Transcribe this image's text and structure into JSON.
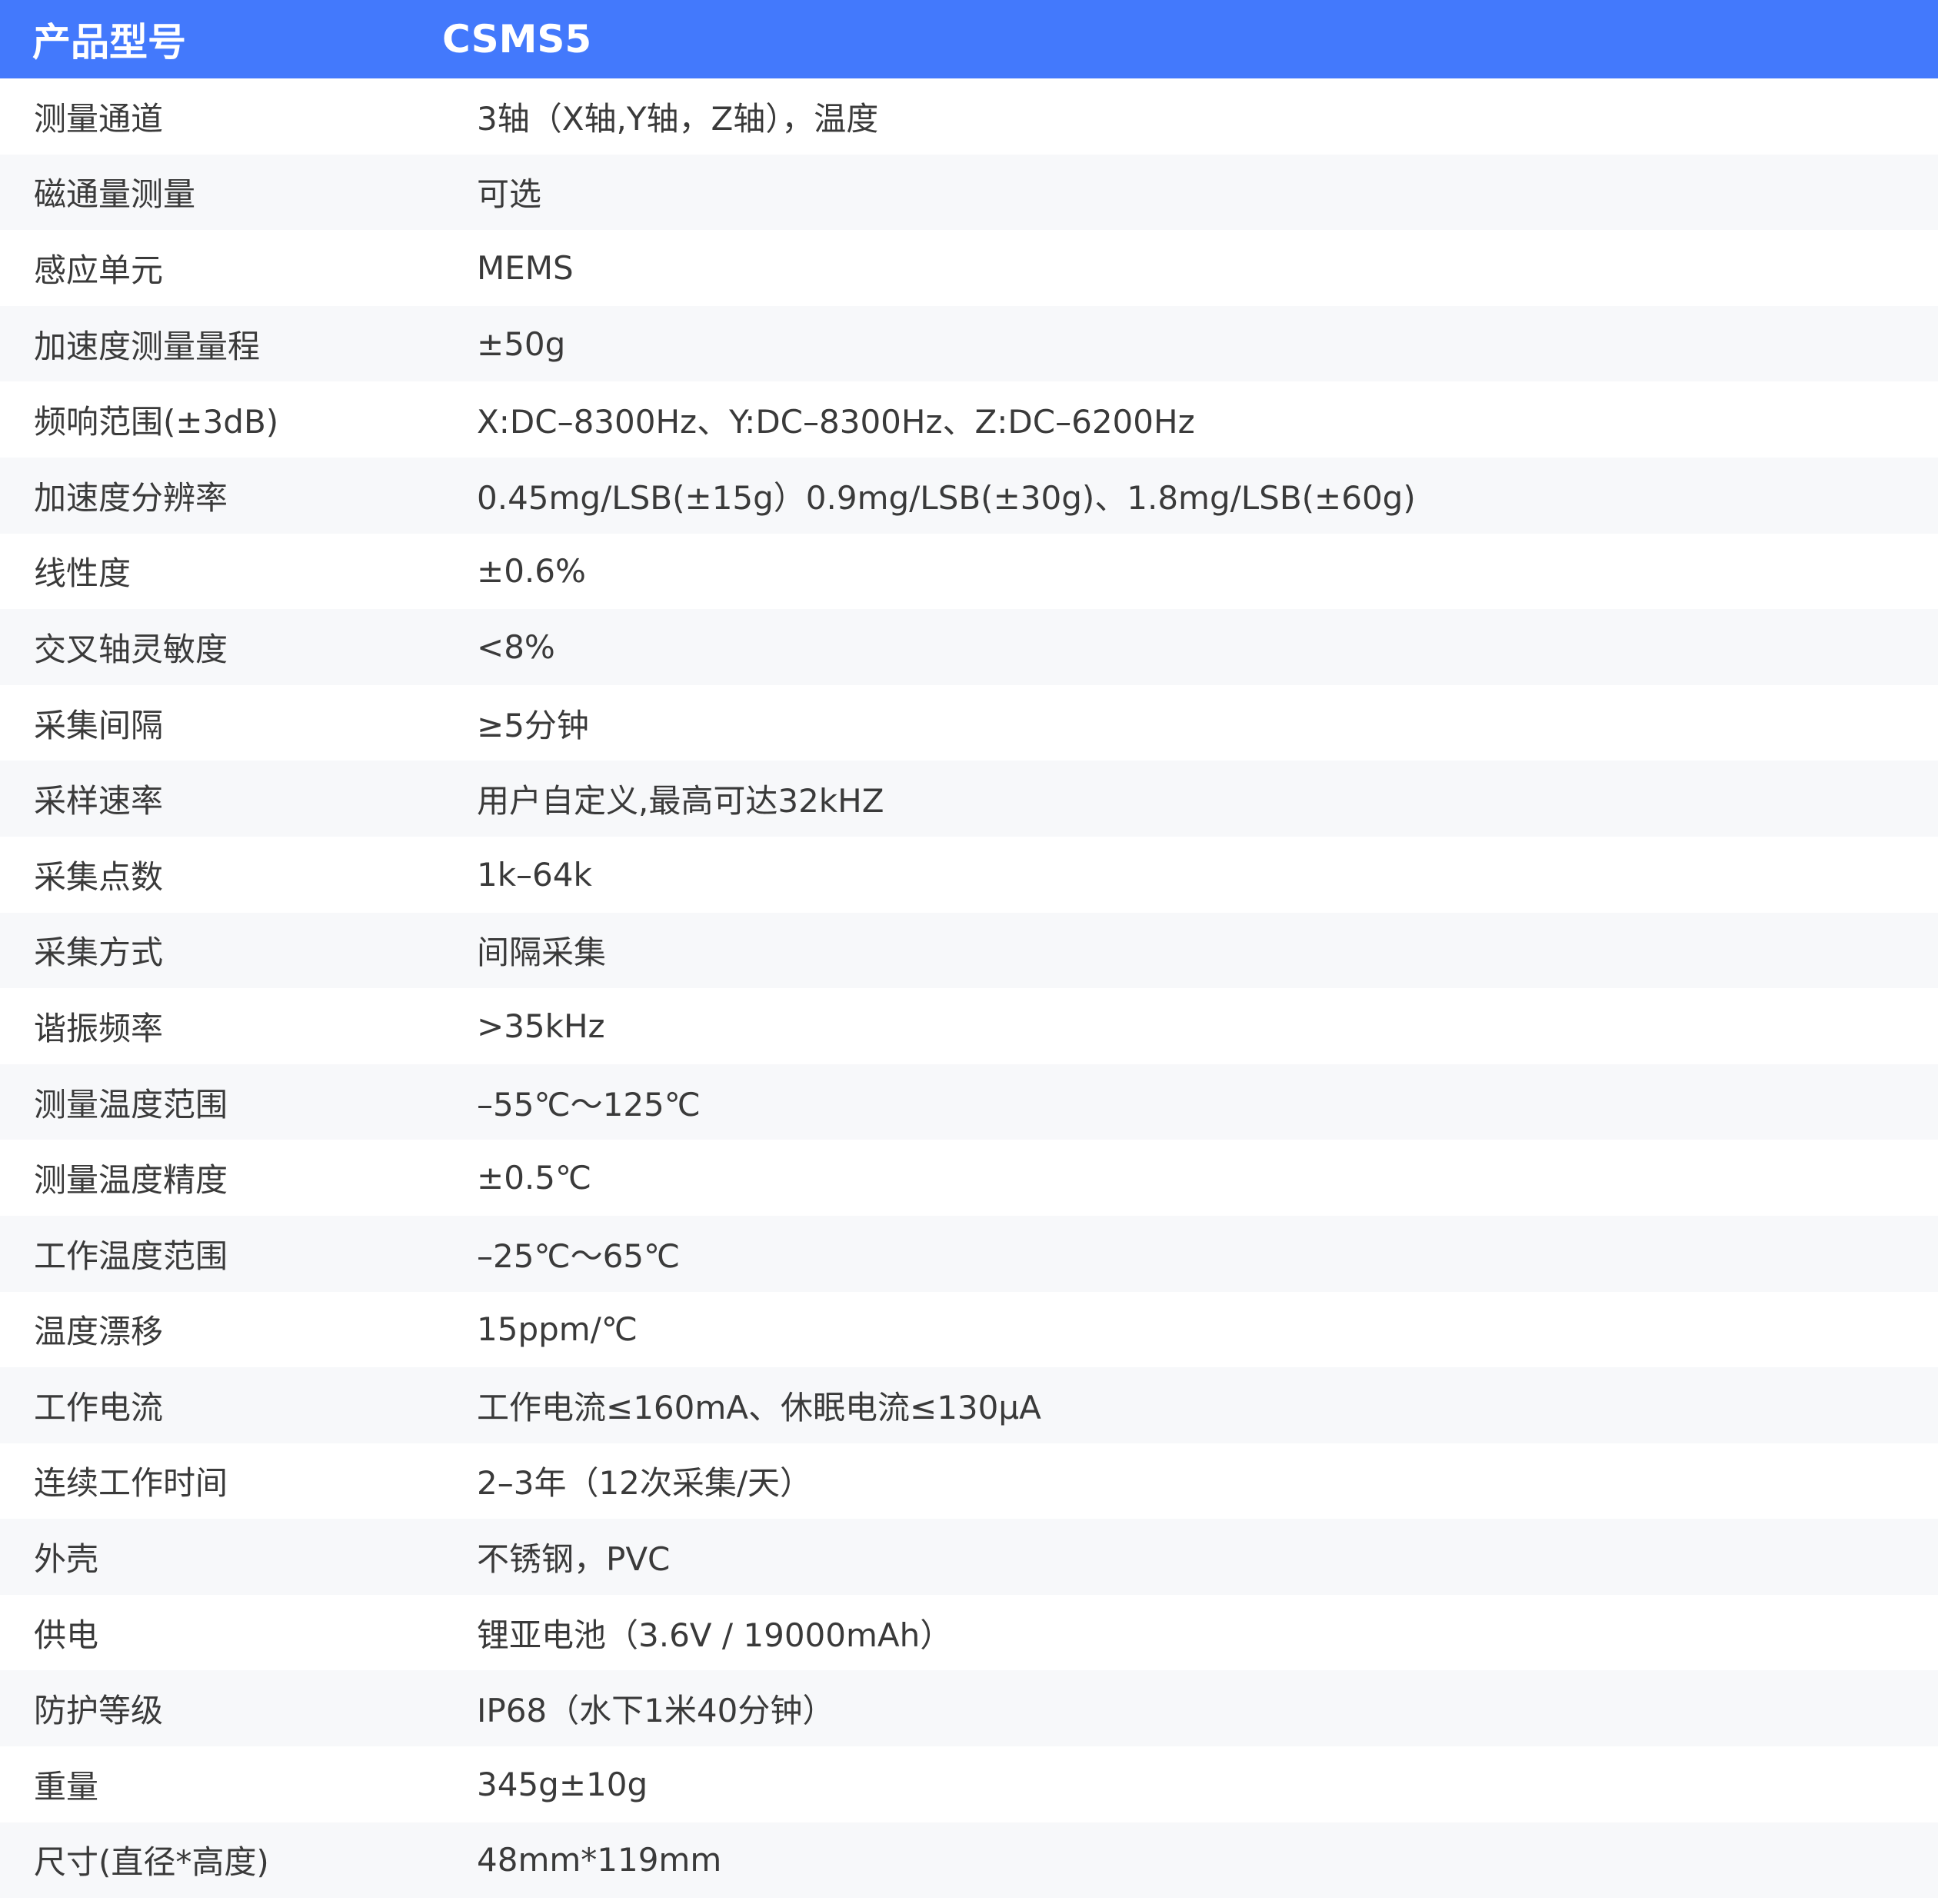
{
  "colors": {
    "header_bg": "#4379fc",
    "header_text": "#ffffff",
    "body_text": "#3a3a3a",
    "stripe": "#f7f8fa"
  },
  "header": {
    "label": "产品型号",
    "value": "CSMS5"
  },
  "rows": [
    {
      "label": "测量通道",
      "value": "3轴（X轴,Y轴，Z轴），温度"
    },
    {
      "label": "磁通量测量",
      "value": "可选"
    },
    {
      "label": "感应单元",
      "value": "MEMS"
    },
    {
      "label": "加速度测量量程",
      "value": "±50g"
    },
    {
      "label": "频响范围(±3dB)",
      "value": "X:DC–8300Hz、Y:DC–8300Hz、Z:DC–6200Hz"
    },
    {
      "label": "加速度分辨率",
      "value": "0.45mg/LSB(±15g）0.9mg/LSB(±30g)、1.8mg/LSB(±60g)"
    },
    {
      "label": "线性度",
      "value": "±0.6%"
    },
    {
      "label": "交叉轴灵敏度",
      "value": "<8%"
    },
    {
      "label": "采集间隔",
      "value": "≥5分钟"
    },
    {
      "label": "采样速率",
      "value": "用户自定义,最高可达32kHZ"
    },
    {
      "label": "采集点数",
      "value": "1k–64k"
    },
    {
      "label": "采集方式",
      "value": "间隔采集"
    },
    {
      "label": "谐振频率",
      "value": ">35kHz"
    },
    {
      "label": "测量温度范围",
      "value": "–55℃～125℃"
    },
    {
      "label": "测量温度精度",
      "value": "±0.5℃"
    },
    {
      "label": "工作温度范围",
      "value": "–25℃～65℃"
    },
    {
      "label": "温度漂移",
      "value": "15ppm/℃"
    },
    {
      "label": "工作电流",
      "value": "工作电流≤160mA、休眠电流≤130μA"
    },
    {
      "label": "连续工作时间",
      "value": "2–3年（12次采集/天）"
    },
    {
      "label": "外壳",
      "value": "不锈钢，PVC"
    },
    {
      "label": "供电",
      "value": "锂亚电池（3.6V / 19000mAh）"
    },
    {
      "label": "防护等级",
      "value": "IP68（水下1米40分钟）"
    },
    {
      "label": "重量",
      "value": "345g±10g"
    },
    {
      "label": "尺寸(直径*高度)",
      "value": "48mm*119mm"
    }
  ]
}
